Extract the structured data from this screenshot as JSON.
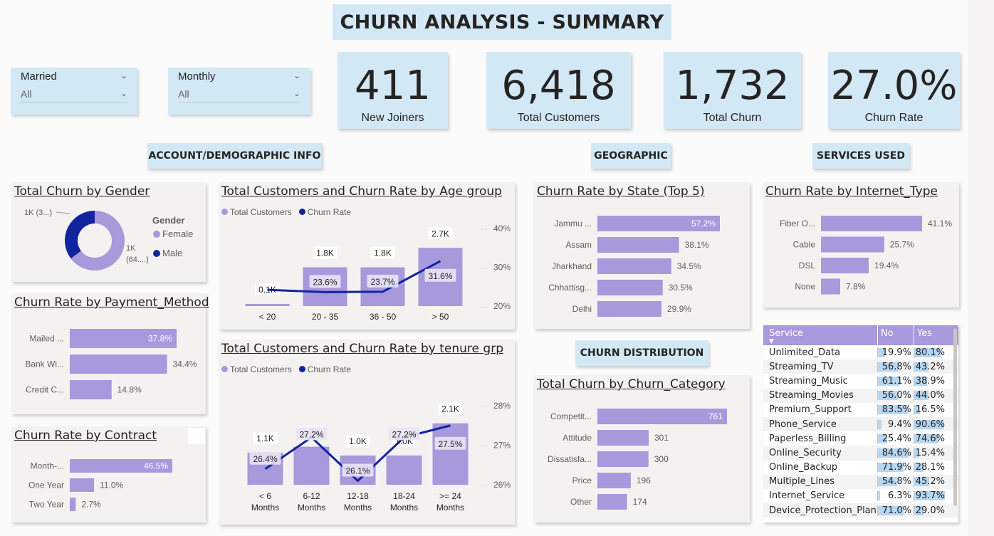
{
  "title": "CHURN ANALYSIS - SUMMARY",
  "slicers": [
    {
      "label": "Married",
      "value": "All"
    },
    {
      "label": "Monthly",
      "value": "All"
    }
  ],
  "kpis": [
    {
      "value": "411",
      "label": "New Joiners"
    },
    {
      "value": "6,418",
      "label": "Total Customers"
    },
    {
      "value": "1,732",
      "label": "Total Churn"
    },
    {
      "value": "27.0%",
      "label": "Churn Rate"
    }
  ],
  "sections": {
    "account": "ACCOUNT/DEMOGRAPHIC INFO",
    "geographic": "GEOGRAPHIC",
    "services": "SERVICES USED",
    "distribution": "CHURN DISTRIBUTION"
  },
  "colors": {
    "accent": "#a898dc",
    "dark": "#12239e",
    "header_bg": "#d3e8f5",
    "table_fill": "#b6d7f2"
  },
  "chart_data": [
    {
      "id": "gender",
      "type": "pie",
      "title": "Total Churn by Gender",
      "legend_title": "Gender",
      "categories": [
        "Female",
        "Male"
      ],
      "values": [
        1100,
        600
      ],
      "labels": [
        "1K (64....)",
        "1K (3...)"
      ],
      "colors": [
        "#a898dc",
        "#12239e"
      ]
    },
    {
      "id": "payment",
      "type": "bar",
      "title": "Churn Rate by Payment_Method",
      "categories": [
        "Mailed ...",
        "Bank Wi...",
        "Credit C..."
      ],
      "values": [
        37.8,
        34.4,
        14.8
      ],
      "labels": [
        "37.8%",
        "34.4%",
        "14.8%"
      ]
    },
    {
      "id": "contract",
      "type": "bar",
      "title": "Churn Rate by Contract",
      "categories": [
        "Month-...",
        "One Year",
        "Two Year"
      ],
      "values": [
        46.5,
        11.0,
        2.7
      ],
      "labels": [
        "46.5%",
        "11.0%",
        "2.7%"
      ]
    },
    {
      "id": "age",
      "type": "bar",
      "title": "Total Customers and Churn Rate by Age group",
      "legend": [
        "Total Customers",
        "Churn Rate"
      ],
      "categories": [
        "< 20",
        "20 - 35",
        "36 - 50",
        "> 50"
      ],
      "series": [
        {
          "name": "Total Customers",
          "values": [
            100,
            1800,
            1800,
            2700
          ],
          "labels": [
            "0.1K",
            "1.8K",
            "1.8K",
            "2.7K"
          ]
        },
        {
          "name": "Churn Rate",
          "values": [
            null,
            23.6,
            23.7,
            31.6
          ],
          "labels": [
            "",
            "23.6%",
            "23.7%",
            "31.6%"
          ]
        }
      ],
      "line_values": [
        24.2,
        23.6,
        23.7,
        31.6
      ],
      "y2_ticks": [
        "40%",
        "30%",
        "20%"
      ],
      "y2lim": [
        20,
        40
      ]
    },
    {
      "id": "tenure",
      "type": "bar",
      "title": "Total Customers and Churn Rate by tenure grp",
      "legend": [
        "Total Customers",
        "Churn Rate"
      ],
      "categories": [
        "< 6 Months",
        "6-12 Months",
        "12-18 Months",
        "18-24 Months",
        ">= 24 Months"
      ],
      "series": [
        {
          "name": "Total Customers",
          "values": [
            1100,
            1300,
            1000,
            1000,
            2100
          ],
          "labels": [
            "1.1K",
            "1.3K",
            "1.0K",
            "1.0K",
            "2.1K"
          ]
        },
        {
          "name": "Churn Rate",
          "values": [
            26.4,
            27.2,
            26.1,
            27.2,
            27.5
          ],
          "labels": [
            "26.4%",
            "27.2%",
            "26.1%",
            "27.2%",
            "27.5%"
          ]
        }
      ],
      "y2_ticks": [
        "28%",
        "27%",
        "26%"
      ],
      "y2lim": [
        26,
        28
      ]
    },
    {
      "id": "state",
      "type": "bar",
      "title": "Churn Rate by State (Top 5)",
      "categories": [
        "Jammu ...",
        "Assam",
        "Jharkhand",
        "Chhattisg...",
        "Delhi"
      ],
      "values": [
        57.2,
        38.1,
        34.5,
        30.5,
        29.9
      ],
      "labels": [
        "57.2%",
        "38.1%",
        "34.5%",
        "30.5%",
        "29.9%"
      ]
    },
    {
      "id": "category",
      "type": "bar",
      "title": "Total Churn by Churn_Category",
      "categories": [
        "Competit...",
        "Attitude",
        "Dissatisfa...",
        "Price",
        "Other"
      ],
      "values": [
        761,
        301,
        300,
        196,
        174
      ],
      "labels": [
        "761",
        "301",
        "300",
        "196",
        "174"
      ]
    },
    {
      "id": "internet",
      "type": "bar",
      "title": "Churn Rate by Internet_Type",
      "categories": [
        "Fiber O...",
        "Cable",
        "DSL",
        "None"
      ],
      "values": [
        41.1,
        25.7,
        19.4,
        7.8
      ],
      "labels": [
        "41.1%",
        "25.7%",
        "19.4%",
        "7.8%"
      ]
    },
    {
      "id": "services",
      "type": "table",
      "columns": [
        "Service",
        "No",
        "Yes"
      ],
      "rows": [
        [
          "Unlimited_Data",
          "19.9%",
          "80.1%"
        ],
        [
          "Streaming_TV",
          "56.8%",
          "43.2%"
        ],
        [
          "Streaming_Music",
          "61.1%",
          "38.9%"
        ],
        [
          "Streaming_Movies",
          "56.0%",
          "44.0%"
        ],
        [
          "Premium_Support",
          "83.5%",
          "16.5%"
        ],
        [
          "Phone_Service",
          "9.4%",
          "90.6%"
        ],
        [
          "Paperless_Billing",
          "25.4%",
          "74.6%"
        ],
        [
          "Online_Security",
          "84.6%",
          "15.4%"
        ],
        [
          "Online_Backup",
          "71.9%",
          "28.1%"
        ],
        [
          "Multiple_Lines",
          "54.8%",
          "45.2%"
        ],
        [
          "Internet_Service",
          "6.3%",
          "93.7%"
        ],
        [
          "Device_Protection_Plan",
          "71.0%",
          "29.0%"
        ]
      ]
    }
  ]
}
